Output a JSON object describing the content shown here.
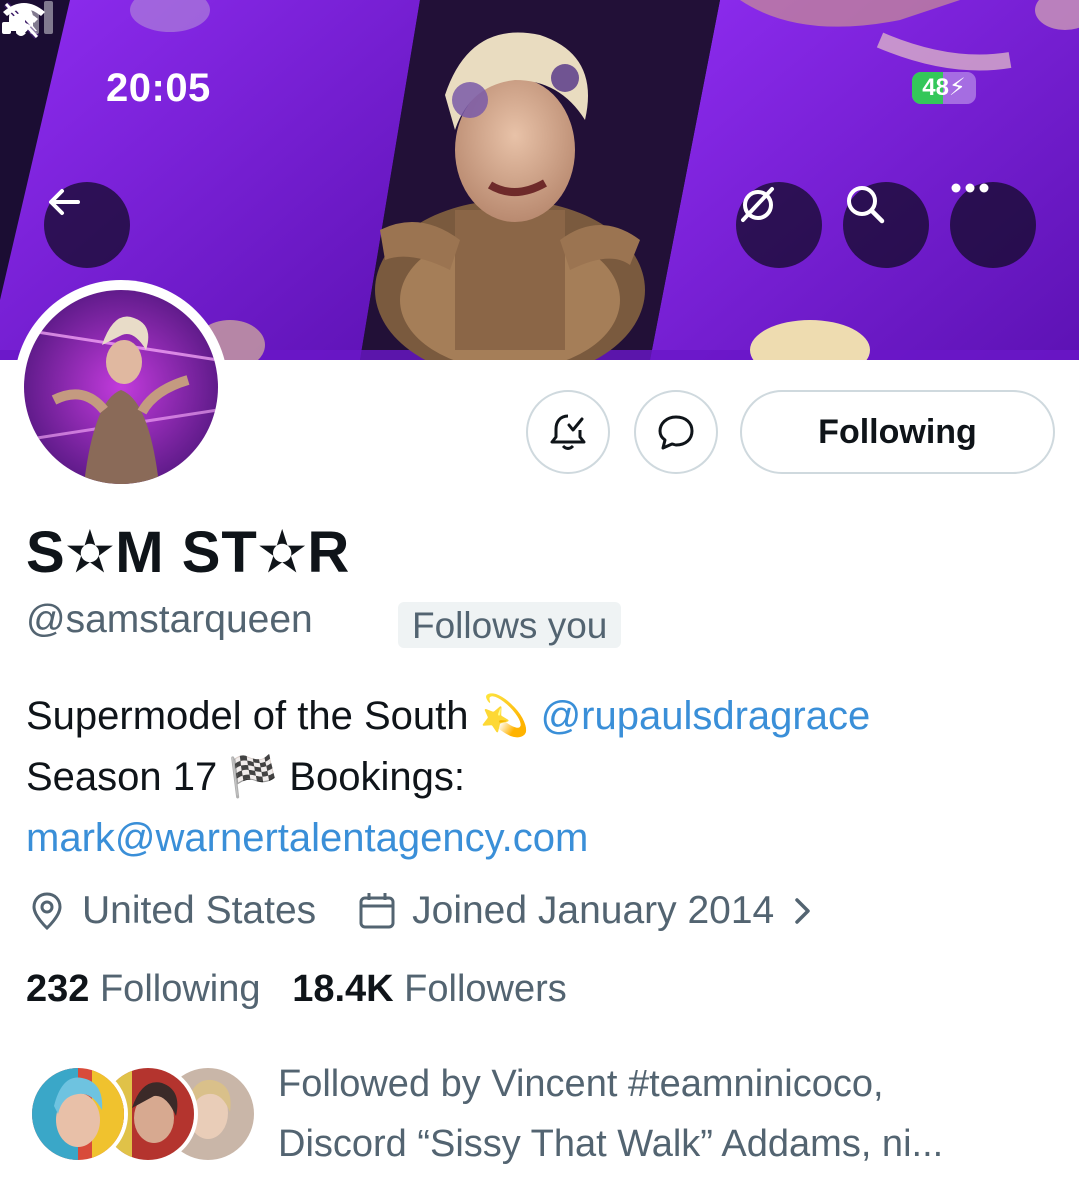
{
  "status_bar": {
    "time": "20:05",
    "battery_percent": 48,
    "battery_label": "48",
    "icons": [
      "bell-slash-icon",
      "signal-icon",
      "wifi-icon",
      "battery-charging-icon"
    ]
  },
  "header_buttons": {
    "back": "arrow-left-icon",
    "grok": "grok-icon",
    "search": "search-icon",
    "more": "more-icon"
  },
  "actions": {
    "notify_icon": "bell-check-icon",
    "message_icon": "message-icon",
    "following_label": "Following"
  },
  "profile": {
    "display_name": "S✫M ST✫R",
    "handle": "@samstarqueen",
    "follows_you": "Follows you",
    "bio": {
      "line1_text": "Supermodel of the South 💫 ",
      "line1_mention": "@rupaulsdragrace",
      "line2_text": "Season 17 🏁 Bookings:",
      "line3_link": "mark@warnertalentagency.com"
    },
    "location": "United States",
    "joined": "Joined January 2014",
    "following_count": "232",
    "following_label": "Following",
    "followers_count": "18.4K",
    "followers_label": "Followers",
    "followed_by_line1": "Followed by Vincent #teamninicoco,",
    "followed_by_line2": "Discord “Sissy That Walk” Addams, ni..."
  },
  "colors": {
    "banner_purple": "#7b1fd8",
    "banner_dark": "#1b0d33",
    "text_primary": "#0f1419",
    "text_secondary": "#536471",
    "link": "#3a8fd8",
    "border": "#cfd9de",
    "battery_green": "#34c759"
  }
}
